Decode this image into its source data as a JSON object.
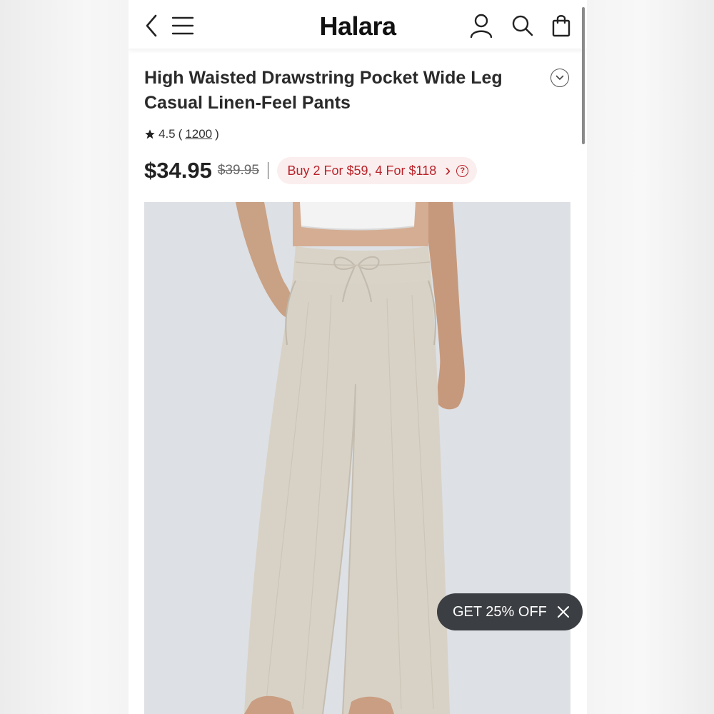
{
  "header": {
    "logo": "Halara",
    "back_icon": "chevron-left-icon",
    "menu_icon": "hamburger-menu-icon",
    "account_icon": "user-icon",
    "search_icon": "search-icon",
    "cart_icon": "shopping-bag-icon"
  },
  "product": {
    "title": "High Waisted Drawstring Pocket Wide Leg Casual Linen-Feel Pants",
    "rating": {
      "score": "4.5",
      "open_paren": "(",
      "count": "1200",
      "close_paren": ")",
      "icon": "star-icon"
    },
    "price": "$34.95",
    "original_price": "$39.95",
    "promo": {
      "text": "Buy 2 For $59, 4 For $118",
      "arrow": "›",
      "help": "?",
      "text_color": "#b8232a",
      "background": "#fbeeee"
    }
  },
  "coupon": {
    "label": "GET 25% OFF",
    "close_icon": "close-icon"
  },
  "colors": {
    "pant_color": "#d8d2c6",
    "photo_background": "#dde0e4",
    "coupon_background": "#3b3e42"
  }
}
